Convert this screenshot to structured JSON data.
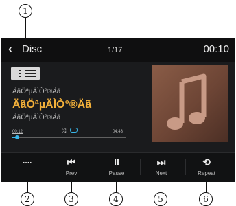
{
  "callouts": [
    "1",
    "2",
    "3",
    "4",
    "5",
    "6"
  ],
  "header": {
    "back_glyph": "‹",
    "title": "Disc",
    "track_counter": "1/17",
    "clock": "00:10"
  },
  "track": {
    "tag_line_1": "ÄãÖªµÄÌÒ°®Äã",
    "tag_line_2": "ÄãÖªµÄÌÒ°®Äã",
    "tag_line_3": "ÄãÖªµÄÌÒ°®Äã",
    "elapsed": "00:12",
    "total": "04:43",
    "progress_fraction": 0.04
  },
  "toolbar": {
    "more_glyph": "····",
    "prev_glyph": "⏮",
    "prev_label": "Prev",
    "pause_glyph": "II",
    "pause_label": "Pause",
    "next_glyph": "⏭",
    "next_label": "Next",
    "repeat_glyph": "⟲",
    "repeat_label": "Repeat"
  },
  "icons": {
    "back": "chevron-left-icon",
    "list": "list-icon",
    "shuffle": "shuffle-icon",
    "repeat_status": "repeat-icon",
    "album_art": "music-note-icon"
  },
  "colors": {
    "accent": "#38b6e8",
    "title_highlight": "#f2b03a",
    "background": "#17181a"
  }
}
